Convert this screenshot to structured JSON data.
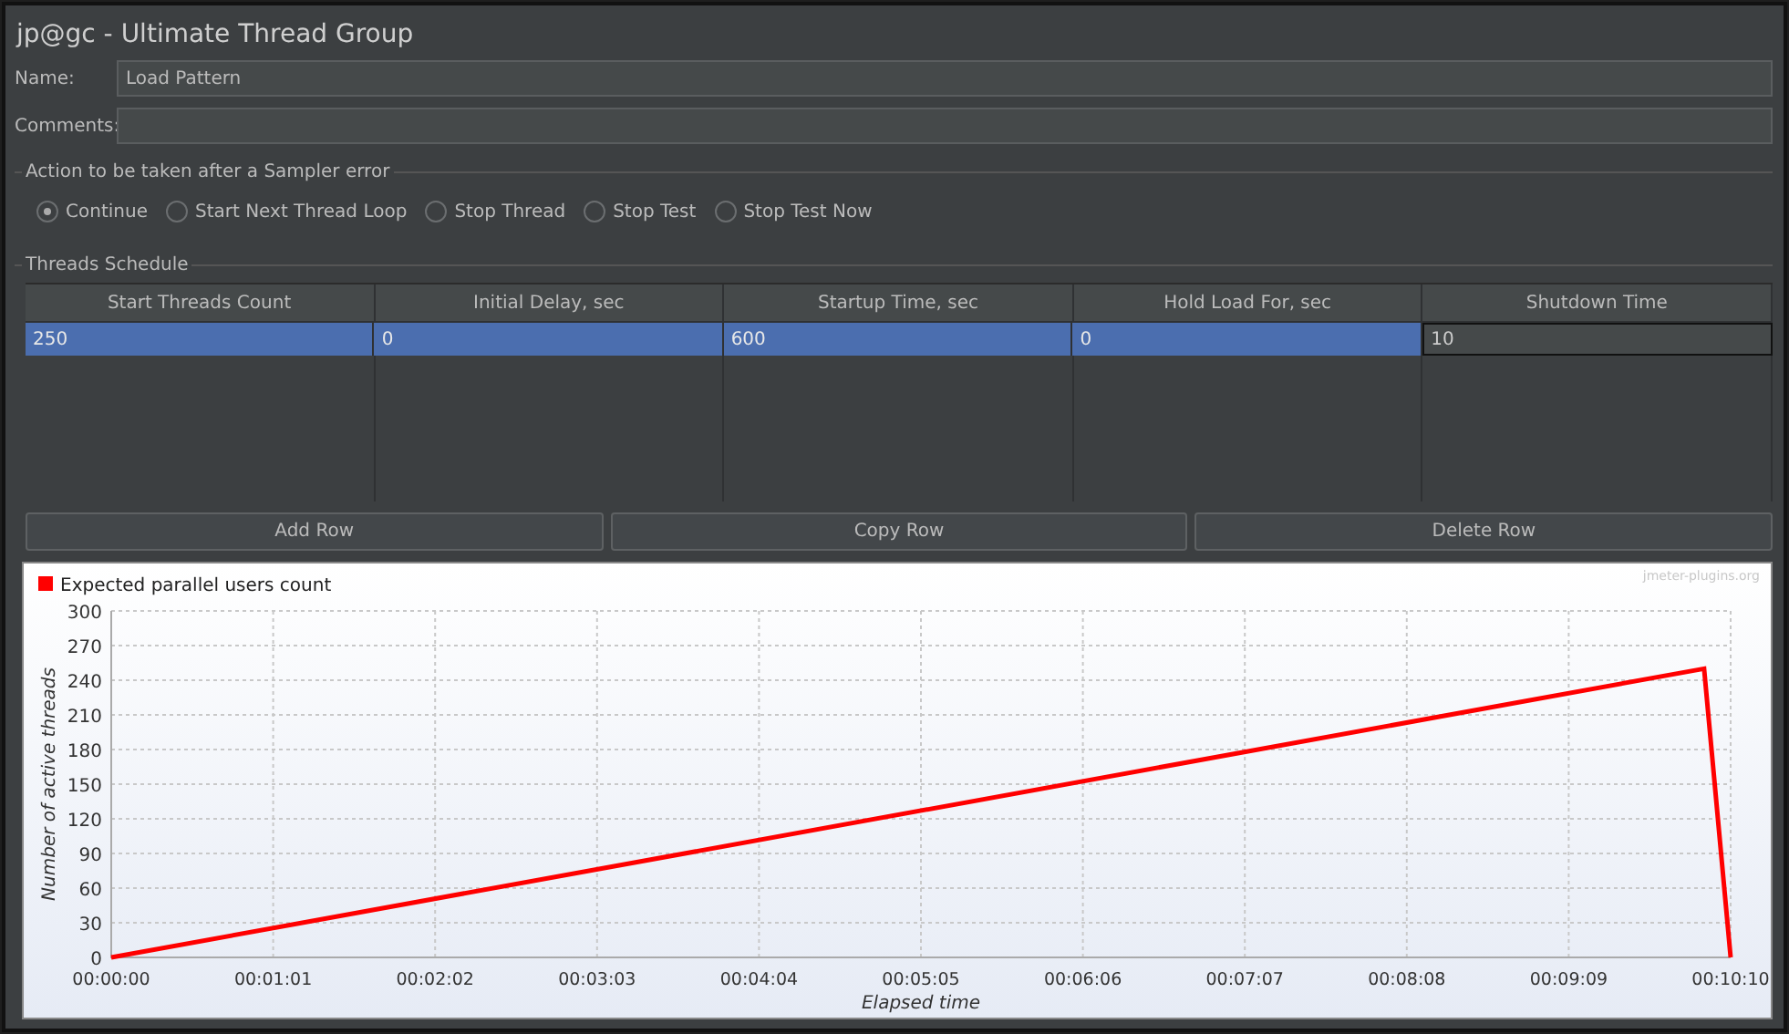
{
  "window": {
    "title": "jp@gc - Ultimate Thread Group"
  },
  "name_field": {
    "label": "Name:",
    "value": "Load Pattern"
  },
  "comments_field": {
    "label": "Comments:"
  },
  "error_action": {
    "legend": "Action to be taken after a Sampler error",
    "options": [
      {
        "label": "Continue",
        "selected": true
      },
      {
        "label": "Start Next Thread Loop",
        "selected": false
      },
      {
        "label": "Stop Thread",
        "selected": false
      },
      {
        "label": "Stop Test",
        "selected": false
      },
      {
        "label": "Stop Test Now",
        "selected": false
      }
    ]
  },
  "schedule": {
    "legend": "Threads Schedule",
    "columns": [
      "Start Threads Count",
      "Initial Delay, sec",
      "Startup Time, sec",
      "Hold Load For, sec",
      "Shutdown Time"
    ],
    "rows": [
      {
        "selected": true,
        "cells": [
          {
            "text": "250",
            "editing": false
          },
          {
            "text": "0",
            "editing": false
          },
          {
            "text": "600",
            "editing": false
          },
          {
            "text": "0",
            "editing": false
          },
          {
            "text": "10",
            "editing": true
          }
        ]
      }
    ]
  },
  "buttons": [
    "Add Row",
    "Copy Row",
    "Delete Row"
  ],
  "chart": {
    "credit": "jmeter-plugins.org",
    "chart_data": {
      "type": "line",
      "xlabel": "Elapsed time",
      "ylabel": "Number of active threads",
      "x": [
        0,
        600,
        610
      ],
      "series": [
        {
          "name": "Expected parallel users count",
          "color": "#ff0000",
          "values": [
            0,
            250,
            0
          ]
        }
      ],
      "grid": true,
      "xlim": [
        0,
        610
      ],
      "ylim": [
        0,
        300
      ],
      "xticks": [
        {
          "value": 0,
          "label": "00:00:00"
        },
        {
          "value": 61,
          "label": "00:01:01"
        },
        {
          "value": 122,
          "label": "00:02:02"
        },
        {
          "value": 183,
          "label": "00:03:03"
        },
        {
          "value": 244,
          "label": "00:04:04"
        },
        {
          "value": 305,
          "label": "00:05:05"
        },
        {
          "value": 366,
          "label": "00:06:06"
        },
        {
          "value": 427,
          "label": "00:07:07"
        },
        {
          "value": 488,
          "label": "00:08:08"
        },
        {
          "value": 549,
          "label": "00:09:09"
        },
        {
          "value": 610,
          "label": "00:10:10"
        }
      ],
      "yticks": [
        0,
        30,
        60,
        90,
        120,
        150,
        180,
        210,
        240,
        270,
        300
      ]
    }
  }
}
